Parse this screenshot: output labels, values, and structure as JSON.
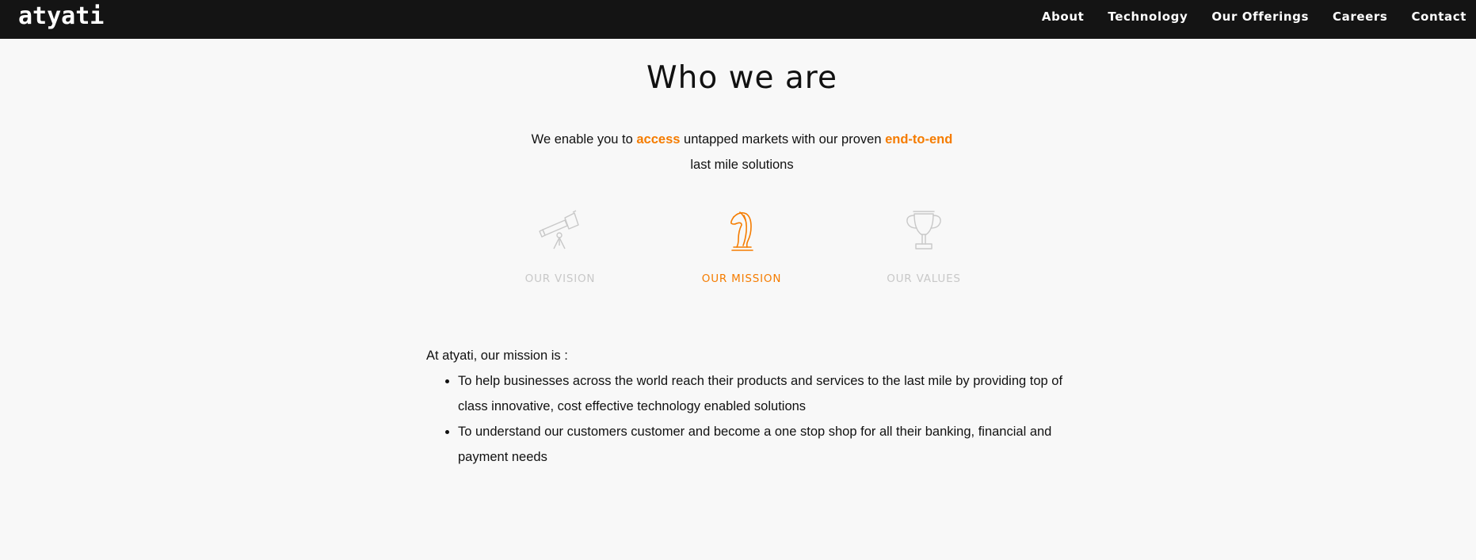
{
  "header": {
    "logo": "atyati",
    "nav": [
      "About",
      "Technology",
      "Our Offerings",
      "Careers",
      "Contact"
    ]
  },
  "main": {
    "title": "Who we are",
    "tagline": {
      "part1": "We enable you to ",
      "highlight1": "access",
      "part2": " untapped markets with our proven ",
      "highlight2": "end-to-end",
      "line2": "last mile solutions"
    },
    "tabs": [
      {
        "label": "OUR VISION",
        "icon": "telescope-icon",
        "active": false
      },
      {
        "label": "OUR MISSION",
        "icon": "knight-icon",
        "active": true
      },
      {
        "label": "OUR VALUES",
        "icon": "trophy-icon",
        "active": false
      }
    ],
    "mission": {
      "intro": "At atyati, our mission is :",
      "points": [
        "To help businesses across the world reach their products and services to the last mile by providing top of class innovative, cost effective technology enabled solutions",
        "To understand our customers customer and become a one stop shop for all their banking, financial and payment needs"
      ]
    }
  },
  "colors": {
    "accent": "#f57c00",
    "navbar": "#141414",
    "background": "#f8f8f8",
    "inactive_tab": "#c8c8c8"
  }
}
